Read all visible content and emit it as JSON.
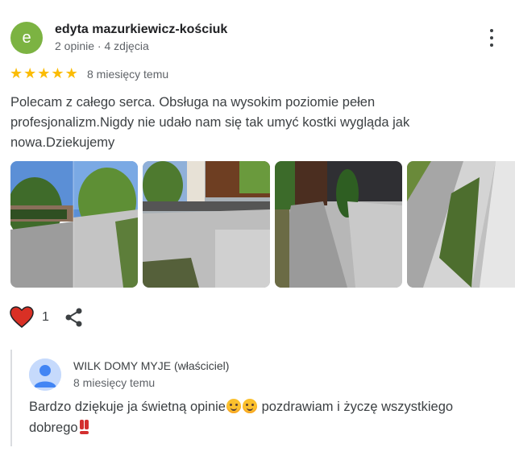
{
  "review": {
    "avatar_letter": "e",
    "avatar_color": "#7cb342",
    "author": "edyta mazurkiewicz-kościuk",
    "author_meta": "2 opinie · 4 zdjęcia",
    "rating": 5,
    "time": "8 miesięcy temu",
    "text": "Polecam z całego serca. Obsługa na wysokim poziomie pełen profesjonalizm.Nigdy nie udało nam się tak umyć kostki wygląda jak nowa.Dziekujemy",
    "likes": "1",
    "photo_count": 4
  },
  "owner_reply": {
    "name": "WILK DOMY MYJE (właściciel)",
    "time": "8 miesięcy temu",
    "text_part1": "Bardzo dziękuje ja świetną opinie",
    "text_part2": " pozdrawiam i życzę wszystkiego dobrego"
  },
  "colors": {
    "star": "#fbbc04",
    "heart": "#d93025",
    "accent_avatar": "#7cb342"
  }
}
